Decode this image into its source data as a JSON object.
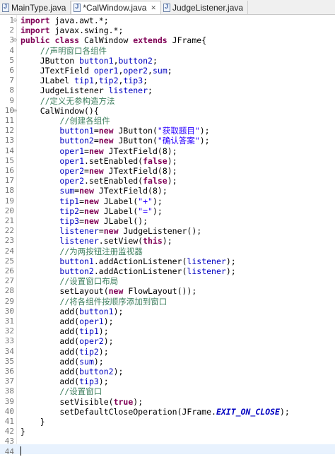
{
  "tabs": [
    {
      "label": "MainType.java",
      "active": false
    },
    {
      "label": "*CalWindow.java",
      "active": true,
      "close": "✕"
    },
    {
      "label": "JudgeListener.java",
      "active": false
    }
  ],
  "code_lines": [
    {
      "n": "1",
      "fold": "⊖",
      "segs": [
        [
          "kw",
          "import"
        ],
        [
          "p",
          " java.awt.*;"
        ]
      ]
    },
    {
      "n": "2",
      "segs": [
        [
          "kw",
          "import"
        ],
        [
          "p",
          " javax.swing.*;"
        ]
      ]
    },
    {
      "n": "3",
      "fold": "⊖",
      "segs": [
        [
          "kw",
          "public class"
        ],
        [
          "p",
          " CalWindow "
        ],
        [
          "kw",
          "extends"
        ],
        [
          "p",
          " JFrame{"
        ]
      ]
    },
    {
      "n": "4",
      "segs": [
        [
          "p",
          "    "
        ],
        [
          "cm",
          "//声明窗口各组件"
        ]
      ]
    },
    {
      "n": "5",
      "segs": [
        [
          "p",
          "    JButton "
        ],
        [
          "fld",
          "button1"
        ],
        [
          "p",
          ","
        ],
        [
          "fld",
          "button2"
        ],
        [
          "p",
          ";"
        ]
      ]
    },
    {
      "n": "6",
      "segs": [
        [
          "p",
          "    JTextField "
        ],
        [
          "fld",
          "oper1"
        ],
        [
          "p",
          ","
        ],
        [
          "fld",
          "oper2"
        ],
        [
          "p",
          ","
        ],
        [
          "fld",
          "sum"
        ],
        [
          "p",
          ";"
        ]
      ]
    },
    {
      "n": "7",
      "segs": [
        [
          "p",
          "    JLabel "
        ],
        [
          "fld",
          "tip1"
        ],
        [
          "p",
          ","
        ],
        [
          "fld",
          "tip2"
        ],
        [
          "p",
          ","
        ],
        [
          "fld",
          "tip3"
        ],
        [
          "p",
          ";"
        ]
      ]
    },
    {
      "n": "8",
      "segs": [
        [
          "p",
          "    JudgeListener "
        ],
        [
          "fld",
          "listener"
        ],
        [
          "p",
          ";"
        ]
      ]
    },
    {
      "n": "9",
      "segs": [
        [
          "p",
          "    "
        ],
        [
          "cm",
          "//定义无参构造方法"
        ]
      ]
    },
    {
      "n": "10",
      "fold": "⊖",
      "segs": [
        [
          "p",
          "    CalWindow(){"
        ]
      ]
    },
    {
      "n": "11",
      "segs": [
        [
          "p",
          "        "
        ],
        [
          "cm",
          "//创建各组件"
        ]
      ]
    },
    {
      "n": "12",
      "segs": [
        [
          "p",
          "        "
        ],
        [
          "fld",
          "button1"
        ],
        [
          "p",
          "="
        ],
        [
          "kw",
          "new"
        ],
        [
          "p",
          " JButton("
        ],
        [
          "str",
          "\"获取题目\""
        ],
        [
          "p",
          ");"
        ]
      ]
    },
    {
      "n": "13",
      "segs": [
        [
          "p",
          "        "
        ],
        [
          "fld",
          "button2"
        ],
        [
          "p",
          "="
        ],
        [
          "kw",
          "new"
        ],
        [
          "p",
          " JButton("
        ],
        [
          "str",
          "\"确认答案\""
        ],
        [
          "p",
          ");"
        ]
      ]
    },
    {
      "n": "14",
      "segs": [
        [
          "p",
          "        "
        ],
        [
          "fld",
          "oper1"
        ],
        [
          "p",
          "="
        ],
        [
          "kw",
          "new"
        ],
        [
          "p",
          " JTextField(8);"
        ]
      ]
    },
    {
      "n": "15",
      "segs": [
        [
          "p",
          "        "
        ],
        [
          "fld",
          "oper1"
        ],
        [
          "p",
          ".setEnabled("
        ],
        [
          "kw",
          "false"
        ],
        [
          "p",
          ");"
        ]
      ]
    },
    {
      "n": "16",
      "segs": [
        [
          "p",
          "        "
        ],
        [
          "fld",
          "oper2"
        ],
        [
          "p",
          "="
        ],
        [
          "kw",
          "new"
        ],
        [
          "p",
          " JTextField(8);"
        ]
      ]
    },
    {
      "n": "17",
      "segs": [
        [
          "p",
          "        "
        ],
        [
          "fld",
          "oper2"
        ],
        [
          "p",
          ".setEnabled("
        ],
        [
          "kw",
          "false"
        ],
        [
          "p",
          ");"
        ]
      ]
    },
    {
      "n": "18",
      "segs": [
        [
          "p",
          "        "
        ],
        [
          "fld",
          "sum"
        ],
        [
          "p",
          "="
        ],
        [
          "kw",
          "new"
        ],
        [
          "p",
          " JTextField(8);"
        ]
      ]
    },
    {
      "n": "19",
      "segs": [
        [
          "p",
          "        "
        ],
        [
          "fld",
          "tip1"
        ],
        [
          "p",
          "="
        ],
        [
          "kw",
          "new"
        ],
        [
          "p",
          " JLabel("
        ],
        [
          "str",
          "\"+\""
        ],
        [
          "p",
          ");"
        ]
      ]
    },
    {
      "n": "20",
      "segs": [
        [
          "p",
          "        "
        ],
        [
          "fld",
          "tip2"
        ],
        [
          "p",
          "="
        ],
        [
          "kw",
          "new"
        ],
        [
          "p",
          " JLabel("
        ],
        [
          "str",
          "\"=\""
        ],
        [
          "p",
          ");"
        ]
      ]
    },
    {
      "n": "21",
      "segs": [
        [
          "p",
          "        "
        ],
        [
          "fld",
          "tip3"
        ],
        [
          "p",
          "="
        ],
        [
          "kw",
          "new"
        ],
        [
          "p",
          " JLabel();"
        ]
      ]
    },
    {
      "n": "22",
      "segs": [
        [
          "p",
          "        "
        ],
        [
          "fld",
          "listener"
        ],
        [
          "p",
          "="
        ],
        [
          "kw",
          "new"
        ],
        [
          "p",
          " JudgeListener();"
        ]
      ]
    },
    {
      "n": "23",
      "segs": [
        [
          "p",
          "        "
        ],
        [
          "fld",
          "listener"
        ],
        [
          "p",
          ".setView("
        ],
        [
          "kw",
          "this"
        ],
        [
          "p",
          ");"
        ]
      ]
    },
    {
      "n": "24",
      "segs": [
        [
          "p",
          "        "
        ],
        [
          "cm",
          "//为两按钮注册监视器"
        ]
      ]
    },
    {
      "n": "25",
      "segs": [
        [
          "p",
          "        "
        ],
        [
          "fld",
          "button1"
        ],
        [
          "p",
          ".addActionListener("
        ],
        [
          "fld",
          "listener"
        ],
        [
          "p",
          ");"
        ]
      ]
    },
    {
      "n": "26",
      "segs": [
        [
          "p",
          "        "
        ],
        [
          "fld",
          "button2"
        ],
        [
          "p",
          ".addActionListener("
        ],
        [
          "fld",
          "listener"
        ],
        [
          "p",
          ");"
        ]
      ]
    },
    {
      "n": "27",
      "segs": [
        [
          "p",
          "        "
        ],
        [
          "cm",
          "//设置窗口布局"
        ]
      ]
    },
    {
      "n": "28",
      "segs": [
        [
          "p",
          "        setLayout("
        ],
        [
          "kw",
          "new"
        ],
        [
          "p",
          " FlowLayout());"
        ]
      ]
    },
    {
      "n": "29",
      "segs": [
        [
          "p",
          "        "
        ],
        [
          "cm",
          "//将各组件按顺序添加到窗口"
        ]
      ]
    },
    {
      "n": "30",
      "segs": [
        [
          "p",
          "        add("
        ],
        [
          "fld",
          "button1"
        ],
        [
          "p",
          ");"
        ]
      ]
    },
    {
      "n": "31",
      "segs": [
        [
          "p",
          "        add("
        ],
        [
          "fld",
          "oper1"
        ],
        [
          "p",
          ");"
        ]
      ]
    },
    {
      "n": "32",
      "segs": [
        [
          "p",
          "        add("
        ],
        [
          "fld",
          "tip1"
        ],
        [
          "p",
          ");"
        ]
      ]
    },
    {
      "n": "33",
      "segs": [
        [
          "p",
          "        add("
        ],
        [
          "fld",
          "oper2"
        ],
        [
          "p",
          ");"
        ]
      ]
    },
    {
      "n": "34",
      "segs": [
        [
          "p",
          "        add("
        ],
        [
          "fld",
          "tip2"
        ],
        [
          "p",
          ");"
        ]
      ]
    },
    {
      "n": "35",
      "segs": [
        [
          "p",
          "        add("
        ],
        [
          "fld",
          "sum"
        ],
        [
          "p",
          ");"
        ]
      ]
    },
    {
      "n": "36",
      "segs": [
        [
          "p",
          "        add("
        ],
        [
          "fld",
          "button2"
        ],
        [
          "p",
          ");"
        ]
      ]
    },
    {
      "n": "37",
      "segs": [
        [
          "p",
          "        add("
        ],
        [
          "fld",
          "tip3"
        ],
        [
          "p",
          ");"
        ]
      ]
    },
    {
      "n": "38",
      "segs": [
        [
          "p",
          "        "
        ],
        [
          "cm",
          "//设置窗口"
        ]
      ]
    },
    {
      "n": "39",
      "segs": [
        [
          "p",
          "        setVisible("
        ],
        [
          "kw",
          "true"
        ],
        [
          "p",
          ");"
        ]
      ]
    },
    {
      "n": "40",
      "segs": [
        [
          "p",
          "        setDefaultCloseOperation(JFrame."
        ],
        [
          "cst",
          "EXIT_ON_CLOSE"
        ],
        [
          "p",
          ");"
        ]
      ]
    },
    {
      "n": "41",
      "segs": [
        [
          "p",
          "    }"
        ]
      ]
    },
    {
      "n": "42",
      "segs": [
        [
          "p",
          "}"
        ]
      ]
    },
    {
      "n": "43",
      "segs": []
    },
    {
      "n": "44",
      "segs": []
    }
  ]
}
